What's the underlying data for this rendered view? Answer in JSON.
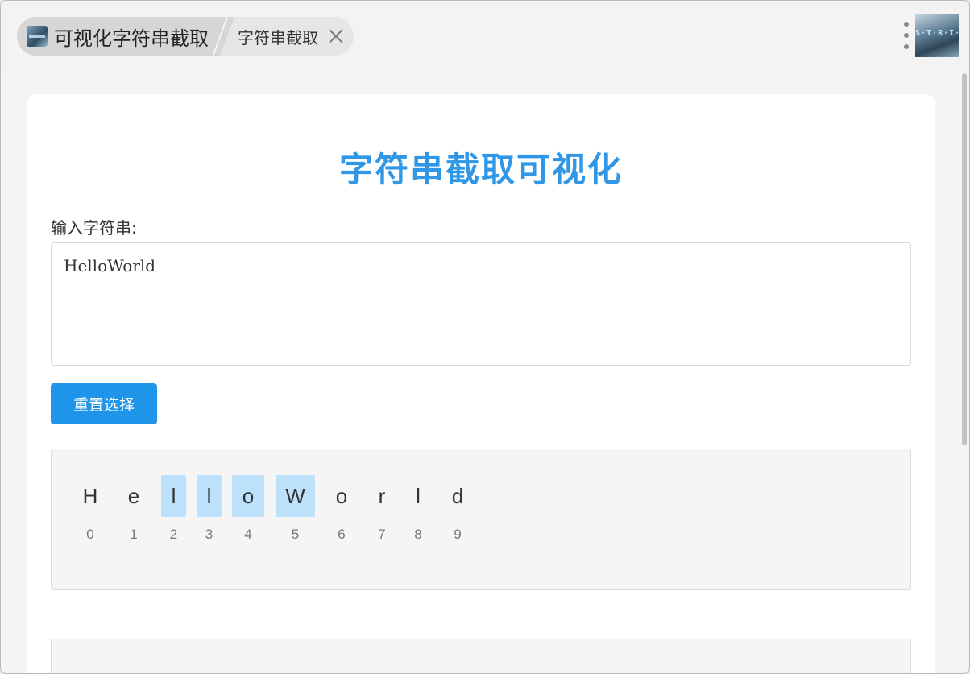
{
  "tabs": {
    "main_label": "可视化字符串截取",
    "sub_label": "字符串截取"
  },
  "app_thumb_text": "S·T·R·I·N·G",
  "page": {
    "title": "字符串截取可视化",
    "input_label": "输入字符串:",
    "input_value": "HelloWorld",
    "reset_button": "重置选择"
  },
  "characters": [
    {
      "char": "H",
      "index": "0",
      "selected": false
    },
    {
      "char": "e",
      "index": "1",
      "selected": false
    },
    {
      "char": "l",
      "index": "2",
      "selected": true
    },
    {
      "char": "l",
      "index": "3",
      "selected": true
    },
    {
      "char": "o",
      "index": "4",
      "selected": true
    },
    {
      "char": "W",
      "index": "5",
      "selected": true
    },
    {
      "char": "o",
      "index": "6",
      "selected": false
    },
    {
      "char": "r",
      "index": "7",
      "selected": false
    },
    {
      "char": "l",
      "index": "8",
      "selected": false
    },
    {
      "char": "d",
      "index": "9",
      "selected": false
    }
  ],
  "colors": {
    "accent": "#2f97e6",
    "button": "#1e95e8",
    "selection": "#bde0fb"
  }
}
